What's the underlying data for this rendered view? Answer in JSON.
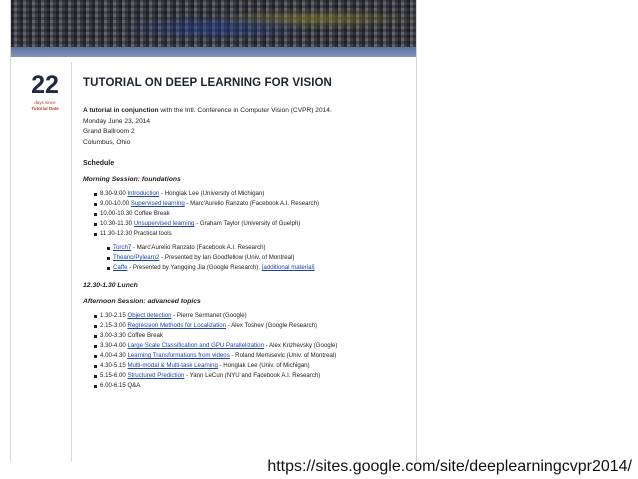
{
  "countdown": {
    "number": "22",
    "label": "days since",
    "caption": "Tutorial Date"
  },
  "page": {
    "title": "TUTORIAL ON DEEP LEARNING FOR VISION",
    "intro_bold": "A tutorial in conjunction",
    "intro_rest": " with the Intl. Conference in Computer Vision (CVPR) 2014.",
    "date": "Monday June 23, 2014",
    "room": "Grand Ballroom 2",
    "city": "Columbus, Ohio",
    "schedule_title": "Schedule"
  },
  "morning": {
    "title": "Morning Session: foundations",
    "items": [
      {
        "time": "8.30-9.00 ",
        "link": "Introduction",
        "rest": " - Honglak Lee (University of Michigan)"
      },
      {
        "time": "9.00-10.00 ",
        "link": "Supervised learning",
        "rest": " - Marc'Aurelio Ranzato (Facebook A.I. Research)"
      },
      {
        "time": "10.00-10.30 Coffee Break",
        "link": "",
        "rest": ""
      },
      {
        "time": "10.30-11.30 ",
        "link": "Unsupervised learning",
        "rest": " - Graham Taylor (University of Guelph)"
      },
      {
        "time": "11.30-12.30 Practical tools",
        "link": "",
        "rest": ""
      }
    ],
    "tools": [
      {
        "link": "Torch7",
        "rest": " - Marc'Aurelio Ranzato (Facebook A.I. Research)",
        "link2": ""
      },
      {
        "link": "Theano/Pylearn2",
        "rest": " - Presented by Ian Goodfellow (Univ. of Montreal)",
        "link2": ""
      },
      {
        "link": "Caffe",
        "rest": " - Presented by Yangqing Jia (Google Research). ",
        "link2": "[additional material]"
      }
    ]
  },
  "lunch": "12.30-1.30 Lunch",
  "afternoon": {
    "title": "Afternoon Session: advanced topics",
    "items": [
      {
        "time": "1.30-2.15 ",
        "link": "Object detection",
        "rest": " - Pierre Sermanet (Google)"
      },
      {
        "time": "2.15-3.00 ",
        "link": "Regression Methods for Localization",
        "rest": " - Alex Toshev (Google Research)"
      },
      {
        "time": "3.00-3.30 Coffee Break",
        "link": "",
        "rest": ""
      },
      {
        "time": "3.30-4.00 ",
        "link": "Large Scale Classification and GPU Parallelization",
        "rest": " - Alex Krizhevsky (Google)"
      },
      {
        "time": "4.00-4.30 ",
        "link": "Learning Transformations from videos",
        "rest": " - Roland Memisevic (Univ. of Montreal)"
      },
      {
        "time": "4.30-5.15 ",
        "link": "Multi-modal & Multi-task Learning",
        "rest": " - Honglak Lee (Univ. of Michigan)"
      },
      {
        "time": "5.15-6.00 ",
        "link": "Structured Prediction",
        "rest": " - Yann LeCun (NYU and Facebook A.I. Research)"
      },
      {
        "time": "6.00-6.15 Q&A",
        "link": "",
        "rest": ""
      }
    ]
  },
  "caption_url": "https://sites.google.com/site/deeplearningcvpr2014/",
  "colors": {
    "link": "#1b44b3",
    "accent_red": "#b03a2e",
    "title": "#1c2433"
  }
}
